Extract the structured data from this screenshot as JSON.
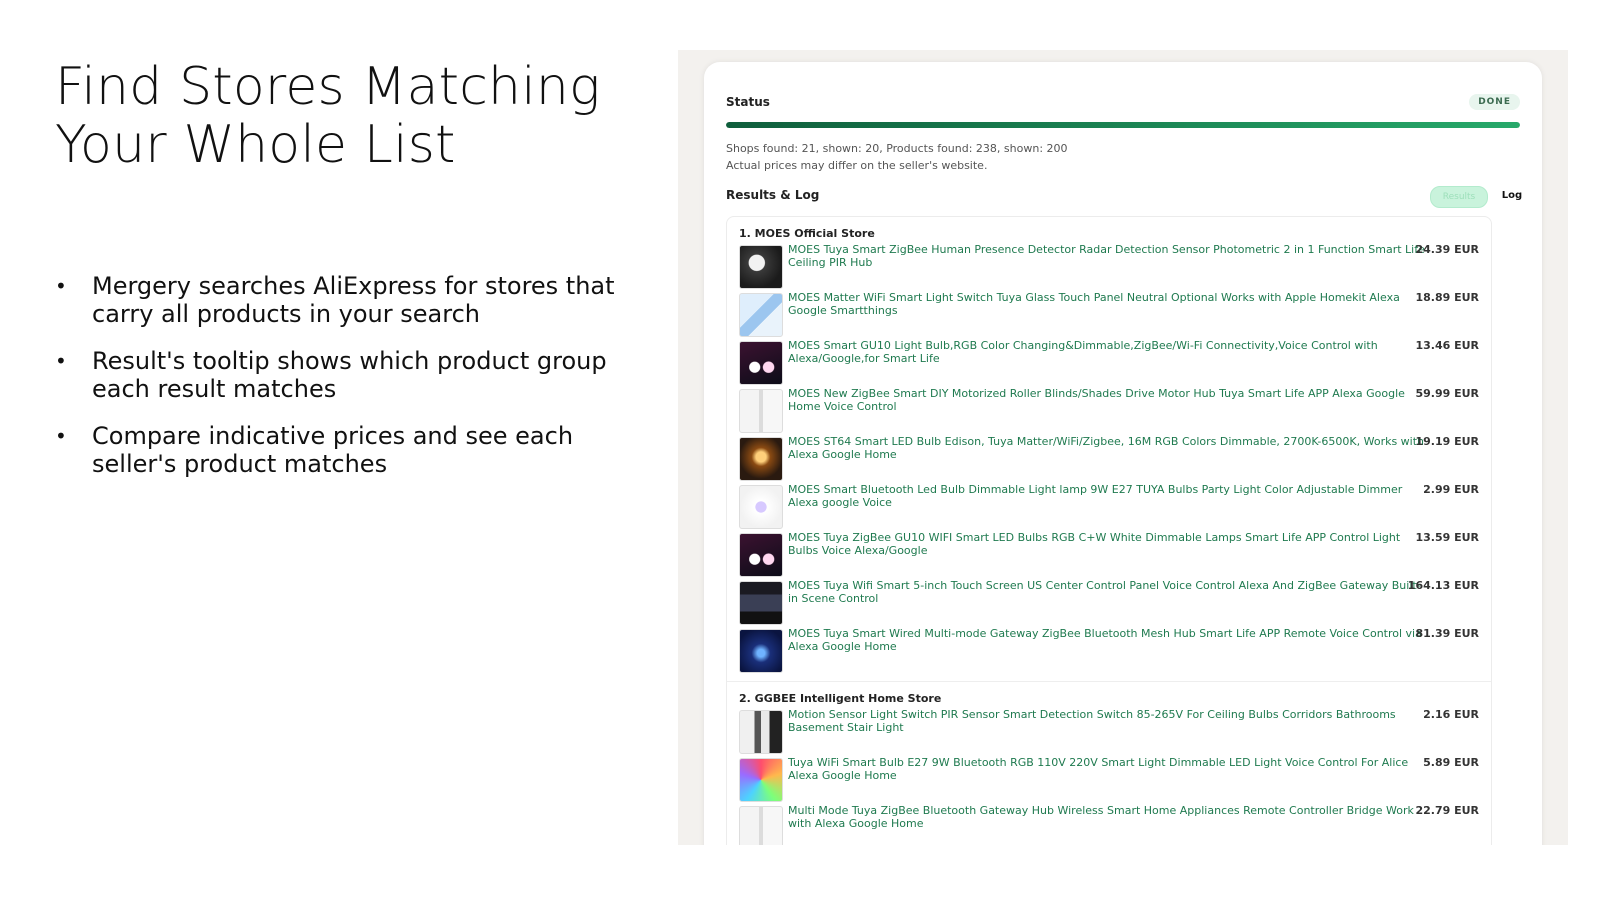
{
  "slide": {
    "title_line1": "Find Stores Matching",
    "title_line2": "Your Whole List",
    "bullets": [
      "Mergery searches AliExpress for stores that carry all products in your search",
      "Result's tooltip shows which product group each result matches",
      "Compare indicative prices and see each seller's product matches"
    ]
  },
  "status": {
    "label": "Status",
    "badge": "DONE",
    "progress_fraction": 1.0,
    "summary_line1": "Shops found: 21, shown: 20, Products found: 238, shown: 200",
    "summary_line2": "Actual prices may differ on the seller's website."
  },
  "results_log": {
    "title": "Results & Log",
    "tab_results": "Results",
    "tab_log": "Log"
  },
  "colors": {
    "accent": "#1f7a4f",
    "progress": "#1a8a58",
    "badge_bg": "#e8f5ee"
  },
  "stores": [
    {
      "name": "1. MOES Official Store",
      "products": [
        {
          "title": "MOES Tuya Smart ZigBee Human Presence Detector Radar Detection Sensor Photometric 2 in 1 Function Smart Life Ceiling PIR Hub",
          "price": "24.39 EUR",
          "thumb": "dark"
        },
        {
          "title": "MOES Matter WiFi Smart Light Switch Tuya Glass Touch Panel Neutral Optional Works with Apple Homekit Alexa Google Smartthings",
          "price": "18.89 EUR",
          "thumb": "blue"
        },
        {
          "title": "MOES Smart GU10 Light Bulb,RGB Color Changing&Dimmable,ZigBee/Wi-Fi Connectivity,Voice Control with Alexa/Google,for Smart Life",
          "price": "13.46 EUR",
          "thumb": "bulb-dark"
        },
        {
          "title": "MOES New ZigBee Smart DIY Motorized Roller Blinds/Shades Drive Motor Hub Tuya Smart Life APP Alexa Google Home Voice Control",
          "price": "59.99 EUR",
          "thumb": "light"
        },
        {
          "title": "MOES ST64 Smart LED Bulb Edison, Tuya Matter/WiFi/Zigbee, 16M RGB Colors Dimmable, 2700K-6500K, Works with Alexa Google Home",
          "price": "19.19 EUR",
          "thumb": "warm"
        },
        {
          "title": "MOES Smart Bluetooth Led Bulb Dimmable Light lamp 9W E27 TUYA Bulbs Party Light Color Adjustable Dimmer Alexa google Voice",
          "price": "2.99 EUR",
          "thumb": "bulb-white"
        },
        {
          "title": "MOES Tuya ZigBee GU10 WIFI Smart LED Bulbs RGB C+W White Dimmable Lamps Smart Life APP Control Light Bulbs Voice Alexa/Google",
          "price": "13.59 EUR",
          "thumb": "bulb-dark"
        },
        {
          "title": "MOES Tuya Wifi Smart 5-inch Touch Screen US Center Control Panel Voice Control Alexa And ZigBee Gateway Built-in Scene Control",
          "price": "164.13 EUR",
          "thumb": "panel"
        },
        {
          "title": "MOES Tuya Smart Wired Multi-mode Gateway ZigBee Bluetooth Mesh Hub Smart Life APP Remote Voice Control via Alexa Google Home",
          "price": "81.39 EUR",
          "thumb": "navy"
        }
      ]
    },
    {
      "name": "2. GGBEE Intelligent Home Store",
      "products": [
        {
          "title": "Motion Sensor Light Switch PIR Sensor Smart Detection Switch 85-265V For Ceiling Bulbs Corridors Bathrooms Basement Stair Light",
          "price": "2.16 EUR",
          "thumb": "stair"
        },
        {
          "title": "Tuya WiFi Smart Bulb E27 9W Bluetooth RGB 110V 220V Smart Light Dimmable LED Light Voice Control For Alice Alexa Google Home",
          "price": "5.89 EUR",
          "thumb": "rgb"
        },
        {
          "title": "Multi Mode Tuya ZigBee Bluetooth Gateway Hub Wireless Smart Home Appliances Remote Controller Bridge Work with Alexa Google Home",
          "price": "22.79 EUR",
          "thumb": "light"
        }
      ]
    }
  ]
}
